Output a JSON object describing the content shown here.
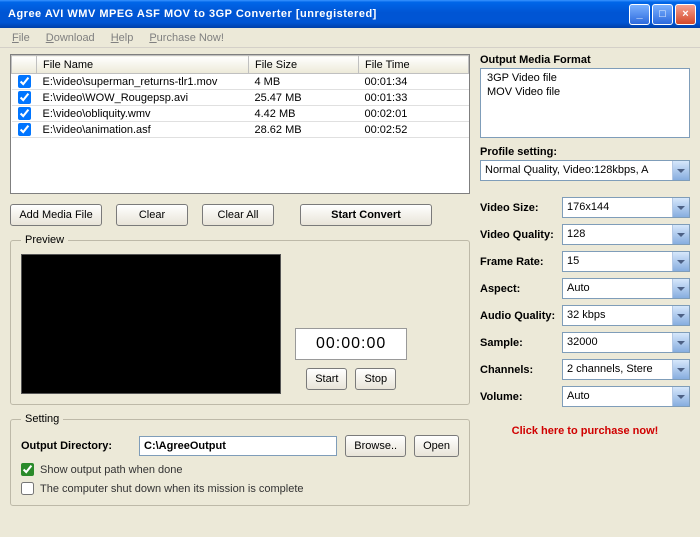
{
  "window": {
    "title": "Agree AVI WMV MPEG ASF MOV to 3GP Converter  [unregistered]"
  },
  "menu": {
    "file": "File",
    "download": "Download",
    "help": "Help",
    "purchase": "Purchase Now!"
  },
  "table": {
    "headers": {
      "name": "File Name",
      "size": "File Size",
      "time": "File Time"
    },
    "rows": [
      {
        "name": "E:\\video\\superman_returns-tlr1.mov",
        "size": "4 MB",
        "time": "00:01:34"
      },
      {
        "name": "E:\\video\\WOW_Rougepsp.avi",
        "size": "25.47 MB",
        "time": "00:01:33"
      },
      {
        "name": "E:\\video\\obliquity.wmv",
        "size": "4.42 MB",
        "time": "00:02:01"
      },
      {
        "name": "E:\\video\\animation.asf",
        "size": "28.62 MB",
        "time": "00:02:52"
      }
    ]
  },
  "buttons": {
    "add": "Add Media File",
    "clear": "Clear",
    "clear_all": "Clear All",
    "start_convert": "Start Convert",
    "start": "Start",
    "stop": "Stop",
    "browse": "Browse..",
    "open": "Open"
  },
  "preview": {
    "legend": "Preview",
    "time": "00:00:00"
  },
  "setting": {
    "legend": "Setting",
    "output_dir_label": "Output Directory:",
    "output_dir": "C:\\AgreeOutput",
    "show_path": "Show output path when done",
    "shutdown": "The computer shut down when its mission is complete"
  },
  "format": {
    "heading": "Output Media Format",
    "items": [
      "3GP Video file",
      "MOV Video file"
    ],
    "profile_label": "Profile setting:",
    "profile": "Normal Quality, Video:128kbps, A"
  },
  "params": {
    "video_size": {
      "label": "Video Size:",
      "value": "176x144"
    },
    "video_quality": {
      "label": "Video Quality:",
      "value": "128"
    },
    "frame_rate": {
      "label": "Frame Rate:",
      "value": "15"
    },
    "aspect": {
      "label": "Aspect:",
      "value": "Auto"
    },
    "audio_quality": {
      "label": "Audio Quality:",
      "value": "32 kbps"
    },
    "sample": {
      "label": "Sample:",
      "value": "32000"
    },
    "channels": {
      "label": "Channels:",
      "value": "2 channels, Stere"
    },
    "volume": {
      "label": "Volume:",
      "value": "Auto"
    }
  },
  "purchase_link": "Click here to purchase now!"
}
